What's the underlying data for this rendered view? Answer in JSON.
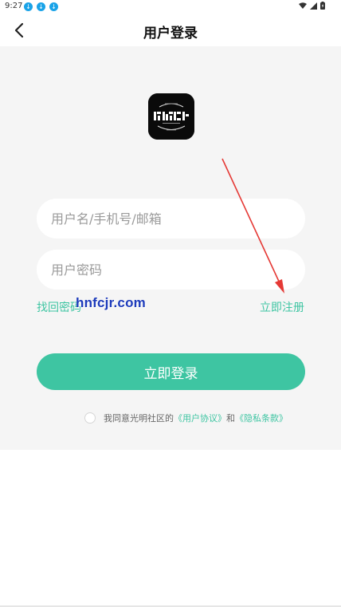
{
  "status_bar": {
    "time": "9:27",
    "notification_icons": [
      "download-icon",
      "download-icon",
      "download-icon"
    ],
    "right_icons": [
      "wifi-icon",
      "signal-icon",
      "battery-icon"
    ]
  },
  "nav": {
    "title": "用户登录",
    "back_icon": "chevron-left-icon"
  },
  "logo": {
    "icon": "app-logo-icon"
  },
  "form": {
    "username_placeholder": "用户名/手机号/邮箱",
    "username_value": "",
    "password_placeholder": "用户密码",
    "password_value": "",
    "forgot_label": "找回密码",
    "register_label": "立即注册",
    "login_label": "立即登录"
  },
  "agreement": {
    "prefix": "我同意光明社区的",
    "user_agreement": "《用户协议》",
    "conjunction": "和",
    "privacy": "《隐私条款》",
    "checked": false
  },
  "watermark": {
    "text": "hnfcjr.com"
  },
  "colors": {
    "accent": "#3ec5a2",
    "background_gray": "#f5f5f5",
    "arrow": "#e53935",
    "watermark": "#1d3bbb"
  }
}
